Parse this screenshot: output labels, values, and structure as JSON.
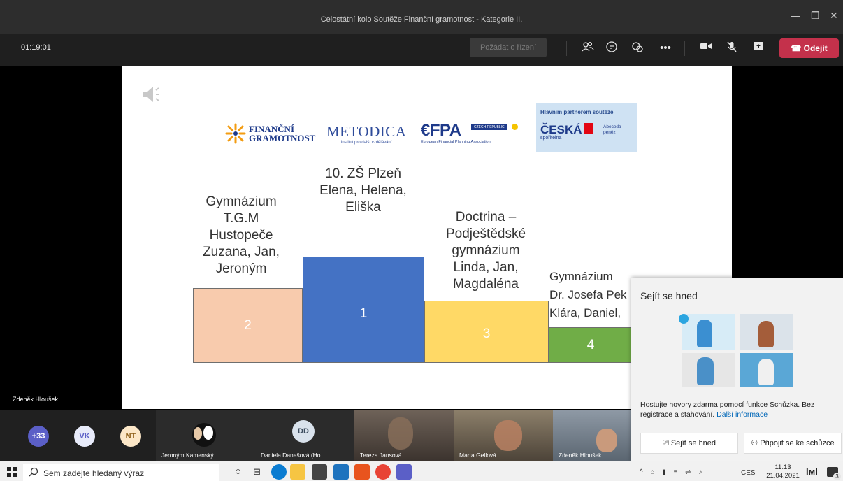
{
  "window": {
    "title": "Celostátní kolo Soutěže Finanční gramotnost - Kategorie II."
  },
  "toolbar": {
    "timer": "01:19:01",
    "request_control": "Požádat o řízení",
    "leave": "Odejít"
  },
  "slide": {
    "logos": {
      "fg_line1": "FINANČNÍ",
      "fg_line2": "GRAMOTNOST",
      "metodica": "METODICA",
      "metodica_sub": "institut pro další vzdělávání",
      "efpa": "€FPA",
      "efpa_badge": "CZECH REPUBLIC",
      "efpa_sub": "European Financial Planning Association",
      "partner_heading": "Hlavním partnerem soutěže",
      "partner_name": "ČESKÁ",
      "partner_sub": "spořitelna",
      "partner_right": "Abeceda peněz"
    },
    "teams": {
      "second": "Gymnázium\nT.G.M\nHustopeče\nZuzana, Jan,\nJeroným",
      "first": "10. ZŠ Plzeň\nElena, Helena,\nEliška",
      "third": "Doctrina –\nPodještědské\ngymnázium\nLinda, Jan,\nMagdaléna",
      "fourth": "Gymnázium\nDr. Josefa Pek\nKlára, Daniel,"
    },
    "places": {
      "first": "1",
      "second": "2",
      "third": "3",
      "fourth": "4"
    },
    "colors": {
      "first": "#4472c4",
      "second": "#f8cbad",
      "third": "#ffd966",
      "fourth": "#70ad47"
    }
  },
  "presenter": "Zdeněk Hloušek",
  "participants": {
    "more": "+33",
    "initials": [
      "VK",
      "NT",
      "DD"
    ],
    "tiles": [
      "Jeroným Kamenský",
      "Daniela Danešová (Ho...",
      "Tereza Jansová",
      "Marta Gellová",
      "Zdeněk Hloušek"
    ]
  },
  "popup": {
    "title": "Sejít se hned",
    "body": "Hostujte hovory zdarma pomocí funkce Schůzka. Bez registrace a stahování.",
    "link": "Další informace",
    "btn_meet": "Sejít se hned",
    "btn_join": "Připojit se ke schůzce"
  },
  "taskbar": {
    "search_placeholder": "Sem zadejte hledaný výraz",
    "lang": "CES",
    "time": "11:13",
    "date": "21.04.2021",
    "notif_count": "3"
  }
}
